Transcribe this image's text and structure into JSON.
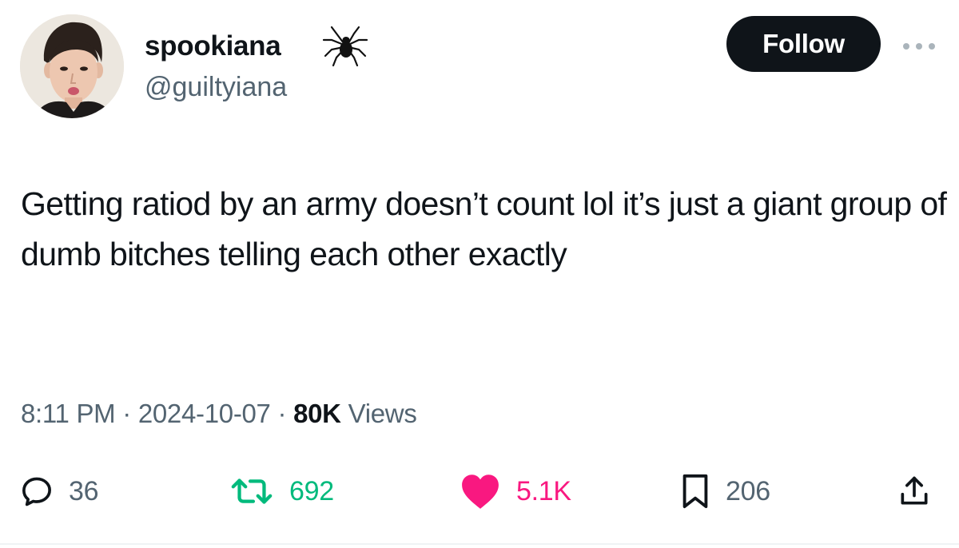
{
  "author": {
    "display_name": "spookiana",
    "name_emoji": "spider-icon",
    "handle": "@guiltyiana"
  },
  "follow_label": "Follow",
  "tweet": {
    "text": "Getting ratiod by an army doesn’t count lol it’s just a giant group of dumb bitches telling each other exactly"
  },
  "meta": {
    "time": "8:11 PM",
    "separator": "·",
    "date": "2024-10-07",
    "views_count": "80K",
    "views_label": "Views"
  },
  "actions": {
    "replies": "36",
    "reposts": "692",
    "likes": "5.1K",
    "bookmarks": "206"
  },
  "colors": {
    "text": "#0f1419",
    "secondary": "#536471",
    "repost": "#00ba7c",
    "like": "#f91880",
    "follow_bg": "#0f1419"
  }
}
